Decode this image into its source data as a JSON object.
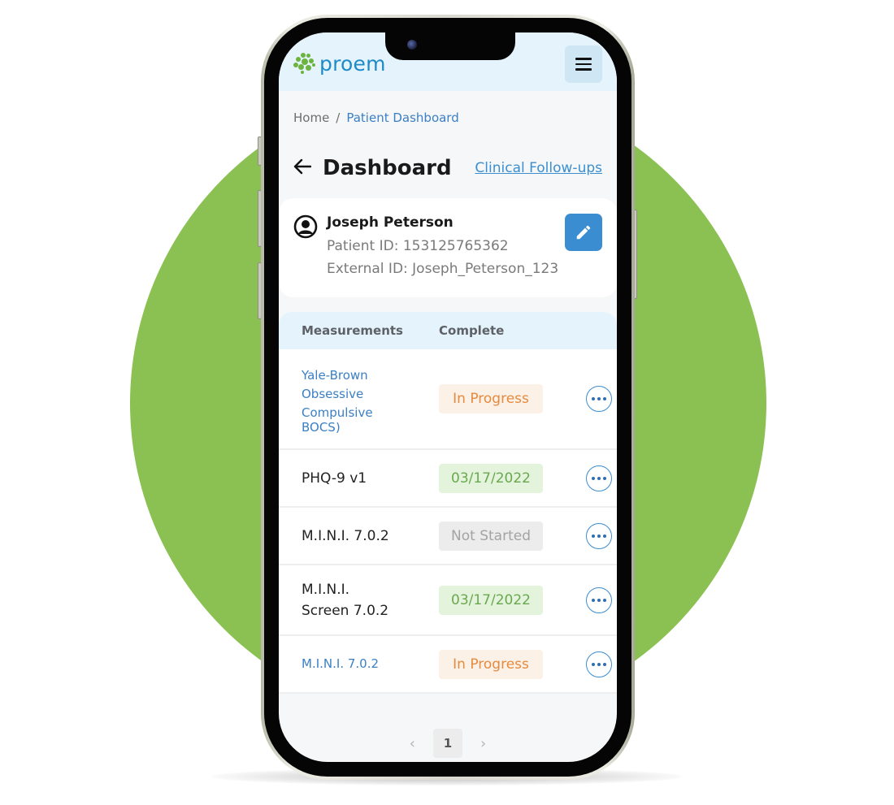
{
  "brand": {
    "name": "proem",
    "logo_color": "#6cb33f",
    "text_color": "#1e8bc8"
  },
  "header": {
    "menu_icon": "hamburger-icon"
  },
  "breadcrumb": {
    "home": "Home",
    "separator": "/",
    "current": "Patient Dashboard"
  },
  "page": {
    "title": "Dashboard",
    "back_icon": "arrow-left-icon",
    "followups_link": "Clinical Follow-ups"
  },
  "patient": {
    "name": "Joseph Peterson",
    "patient_id": "Patient ID: 153125765362",
    "external_id": "External ID: Joseph_Peterson_123",
    "avatar_icon": "user-circle-icon",
    "edit_icon": "pencil-icon"
  },
  "table": {
    "columns": [
      "Measurements",
      "Complete"
    ],
    "rows": [
      {
        "name": "Yale-Brown Obsessive Compulsive BOCS)",
        "name_lines": [
          "Yale-Brown",
          "Obsessive",
          "Compulsive",
          "BOCS)"
        ],
        "status": "In Progress",
        "status_type": "progress",
        "is_link": true
      },
      {
        "name": "PHQ-9 v1",
        "name_lines": [
          "PHQ-9 v1"
        ],
        "status": "03/17/2022",
        "status_type": "done",
        "is_link": false
      },
      {
        "name": "M.I.N.I. 7.0.2",
        "name_lines": [
          "M.I.N.I. 7.0.2"
        ],
        "status": "Not Started",
        "status_type": "notstarted",
        "is_link": false
      },
      {
        "name": "M.I.N.I. Screen 7.0.2",
        "name_lines": [
          "M.I.N.I.",
          "Screen 7.0.2"
        ],
        "status": "03/17/2022",
        "status_type": "done",
        "is_link": false
      },
      {
        "name": "M.I.N.I. 7.0.2",
        "name_lines": [
          "M.I.N.I. 7.0.2"
        ],
        "status": "In Progress",
        "status_type": "progress",
        "is_link": true
      }
    ],
    "row_action_icon": "more-horizontal-icon"
  },
  "pagination": {
    "prev": "‹",
    "current_page": "1",
    "next": "›"
  },
  "colors": {
    "accent": "#3b8dd2",
    "header_bg": "#e4f3fc",
    "background_circle": "#8bc152",
    "in_progress": "#e68a3e",
    "completed": "#6aa84f",
    "not_started": "#a3a3a3"
  }
}
